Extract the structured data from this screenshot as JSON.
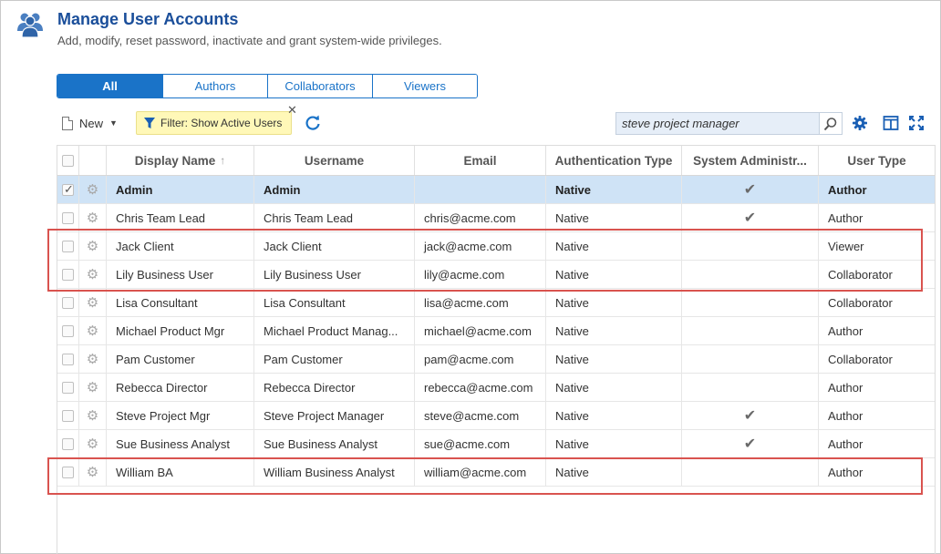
{
  "header": {
    "title": "Manage User Accounts",
    "subtitle": "Add, modify, reset password, inactivate and grant system-wide privileges."
  },
  "tabs": [
    {
      "label": "All",
      "active": true
    },
    {
      "label": "Authors",
      "active": false
    },
    {
      "label": "Collaborators",
      "active": false
    },
    {
      "label": "Viewers",
      "active": false
    }
  ],
  "toolbar": {
    "new_label": "New",
    "filter_label": "Filter: Show Active Users",
    "search_value": "steve project manager"
  },
  "table": {
    "columns": [
      "Display Name",
      "Username",
      "Email",
      "Authentication Type",
      "System Administr...",
      "User Type"
    ],
    "sort_indicator": "↑",
    "rows": [
      {
        "display_name": "Admin",
        "username": "Admin",
        "email": "",
        "auth": "Native",
        "sysadmin": true,
        "user_type": "Author",
        "selected": true
      },
      {
        "display_name": "Chris Team Lead",
        "username": "Chris Team Lead",
        "email": "chris@acme.com",
        "auth": "Native",
        "sysadmin": true,
        "user_type": "Author",
        "selected": false
      },
      {
        "display_name": "Jack Client",
        "username": "Jack Client",
        "email": "jack@acme.com",
        "auth": "Native",
        "sysadmin": false,
        "user_type": "Viewer",
        "selected": false
      },
      {
        "display_name": "Lily Business User",
        "username": "Lily Business User",
        "email": "lily@acme.com",
        "auth": "Native",
        "sysadmin": false,
        "user_type": "Collaborator",
        "selected": false
      },
      {
        "display_name": "Lisa Consultant",
        "username": "Lisa Consultant",
        "email": "lisa@acme.com",
        "auth": "Native",
        "sysadmin": false,
        "user_type": "Collaborator",
        "selected": false
      },
      {
        "display_name": "Michael Product Mgr",
        "username": "Michael Product Manag...",
        "email": "michael@acme.com",
        "auth": "Native",
        "sysadmin": false,
        "user_type": "Author",
        "selected": false
      },
      {
        "display_name": "Pam Customer",
        "username": "Pam Customer",
        "email": "pam@acme.com",
        "auth": "Native",
        "sysadmin": false,
        "user_type": "Collaborator",
        "selected": false
      },
      {
        "display_name": "Rebecca Director",
        "username": "Rebecca Director",
        "email": "rebecca@acme.com",
        "auth": "Native",
        "sysadmin": false,
        "user_type": "Author",
        "selected": false
      },
      {
        "display_name": "Steve Project Mgr",
        "username": "Steve Project Manager",
        "email": "steve@acme.com",
        "auth": "Native",
        "sysadmin": true,
        "user_type": "Author",
        "selected": false
      },
      {
        "display_name": "Sue Business Analyst",
        "username": "Sue Business Analyst",
        "email": "sue@acme.com",
        "auth": "Native",
        "sysadmin": true,
        "user_type": "Author",
        "selected": false
      },
      {
        "display_name": "William BA",
        "username": "William Business Analyst",
        "email": "william@acme.com",
        "auth": "Native",
        "sysadmin": false,
        "user_type": "Author",
        "selected": false
      }
    ]
  },
  "colors": {
    "accent": "#1a73c8",
    "title": "#1a4e9a",
    "selected_row": "#cfe3f6",
    "filter_chip": "#fff8b8",
    "highlight": "#d9534f"
  },
  "icons": [
    "users-icon",
    "new-document-icon",
    "filter-funnel-icon",
    "close-icon",
    "refresh-icon",
    "search-icon",
    "settings-icon",
    "columns-icon",
    "expand-icon",
    "row-gear-icon",
    "checkmark-icon"
  ]
}
